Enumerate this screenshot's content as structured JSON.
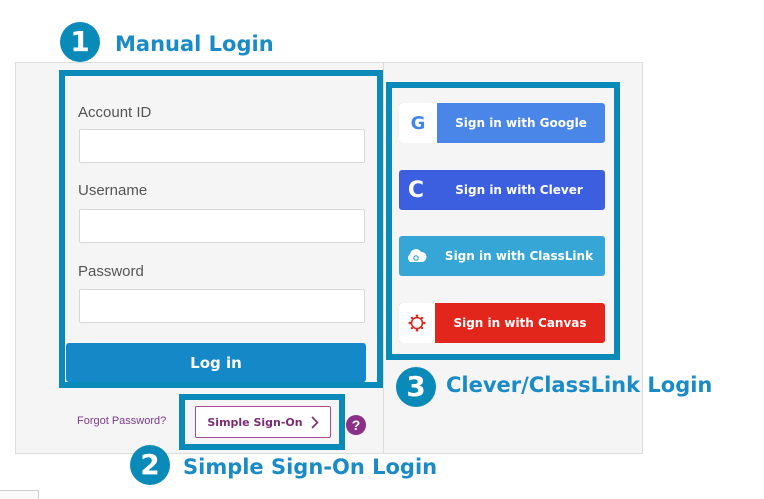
{
  "callouts": [
    {
      "number": "1",
      "title": "Manual Login"
    },
    {
      "number": "2",
      "title": "Simple Sign-On Login"
    },
    {
      "number": "3",
      "title": "Clever/ClassLink Login"
    }
  ],
  "form": {
    "account_label": "Account ID",
    "account_value": "",
    "username_label": "Username",
    "username_value": "",
    "password_label": "Password",
    "password_value": "",
    "login_label": "Log in",
    "forgot_label": "Forgot Password?",
    "sso_label": "Simple Sign-On",
    "help_symbol": "?"
  },
  "providers": [
    {
      "label": "Sign in with Google",
      "icon": "google-icon",
      "color": "#4a86e8"
    },
    {
      "label": "Sign in with Clever",
      "icon": "clever-icon",
      "color": "#3c5fe0"
    },
    {
      "label": "Sign in with ClassLink",
      "icon": "classlink-icon",
      "color": "#35a6d6"
    },
    {
      "label": "Sign in with Canvas",
      "icon": "canvas-icon",
      "color": "#e2261c"
    }
  ],
  "colors": {
    "callout_accent": "#0a8ab9",
    "login_button": "#1588c8",
    "sso_accent": "#a64a93"
  }
}
